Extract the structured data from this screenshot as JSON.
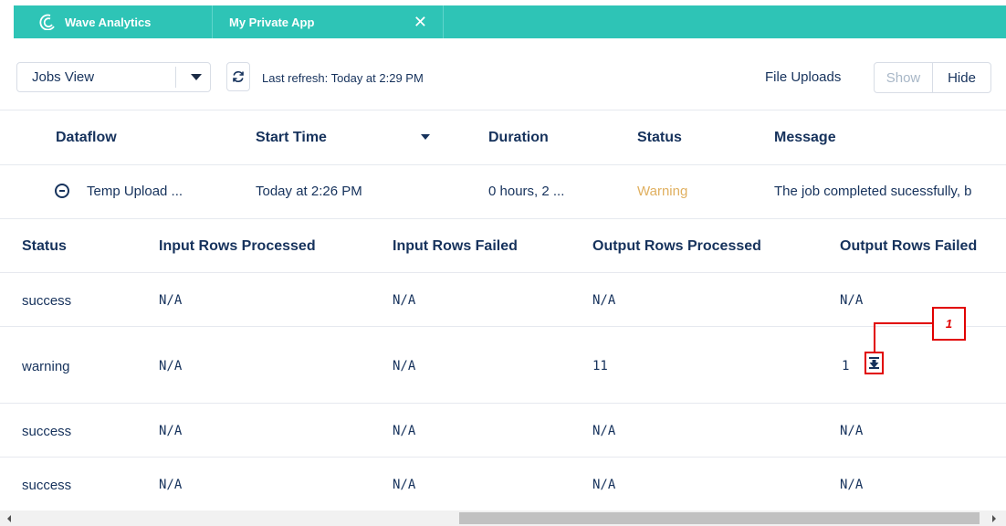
{
  "tabs": {
    "home_label": "Wave Analytics",
    "home_icon": "wave-logo-icon",
    "app_label": "My Private App",
    "close_icon": "close-icon",
    "close_glyph": "✕"
  },
  "toolbar": {
    "view_selected": "Jobs View",
    "refresh_icon": "refresh-icon",
    "last_refresh": "Last refresh: Today at 2:29 PM",
    "file_uploads_label": "File Uploads",
    "show_label": "Show",
    "hide_label": "Hide"
  },
  "jobs": {
    "columns": [
      "Dataflow",
      "Start Time",
      "Duration",
      "Status",
      "Message"
    ],
    "row": {
      "dataflow": "Temp Upload ...",
      "start_time": "Today at 2:26 PM",
      "duration": "0 hours, 2 ...",
      "status": "Warning",
      "message": "The job completed sucessfully, b"
    }
  },
  "details": {
    "columns": [
      "Status",
      "Input Rows Processed",
      "Input Rows Failed",
      "Output Rows Processed",
      "Output Rows Failed"
    ],
    "rows": [
      {
        "status": "success",
        "in_processed": "N/A",
        "in_failed": "N/A",
        "out_processed": "N/A",
        "out_failed": "N/A"
      },
      {
        "status": "warning",
        "in_processed": "N/A",
        "in_failed": "N/A",
        "out_processed": "11",
        "out_failed": "1"
      },
      {
        "status": "success",
        "in_processed": "N/A",
        "in_failed": "N/A",
        "out_processed": "N/A",
        "out_failed": "N/A"
      },
      {
        "status": "success",
        "in_processed": "N/A",
        "in_failed": "N/A",
        "out_processed": "N/A",
        "out_failed": "N/A"
      }
    ]
  },
  "annotation": {
    "callout_label": "1",
    "download_icon": "download-icon"
  },
  "colors": {
    "tab_bar": "#2ec4b6",
    "warning_text": "#e0b060",
    "callout_red": "#e10000"
  }
}
